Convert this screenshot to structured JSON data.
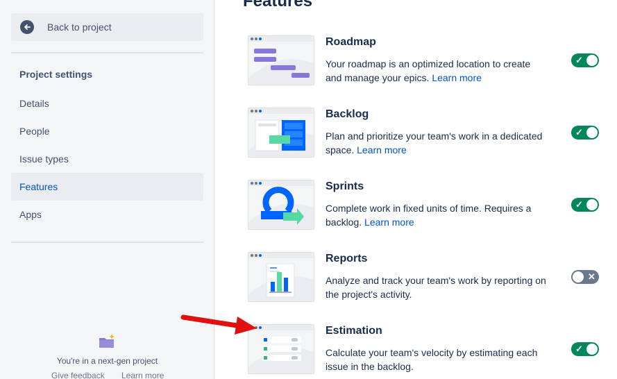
{
  "sidebar": {
    "back_label": "Back to project",
    "section_title": "Project settings",
    "items": [
      {
        "label": "Details",
        "active": false
      },
      {
        "label": "People",
        "active": false
      },
      {
        "label": "Issue types",
        "active": false
      },
      {
        "label": "Features",
        "active": true
      },
      {
        "label": "Apps",
        "active": false
      }
    ],
    "footer_text": "You're in a next-gen project",
    "footer_links": [
      "Give feedback",
      "Learn more"
    ]
  },
  "main": {
    "title": "Features",
    "features": [
      {
        "title": "Roadmap",
        "desc": "Your roadmap is an optimized location to create and manage your epics.",
        "link": "Learn more",
        "enabled": true
      },
      {
        "title": "Backlog",
        "desc": "Plan and prioritize your team's work in a dedicated space.",
        "link": "Learn more",
        "enabled": true
      },
      {
        "title": "Sprints",
        "desc": "Complete work in fixed units of time. Requires a backlog.",
        "link": "Learn more",
        "enabled": true
      },
      {
        "title": "Reports",
        "desc": "Analyze and track your team's work by reporting on the project's activity.",
        "link": "",
        "enabled": false
      },
      {
        "title": "Estimation",
        "desc": "Calculate your team's velocity by estimating each issue in the backlog.",
        "link": "",
        "enabled": true
      }
    ]
  },
  "colors": {
    "accent": "#0052cc",
    "toggle_on": "#00875a",
    "toggle_off": "#6b778c",
    "annotation_arrow": "#e01010"
  },
  "icons": {
    "back": "arrow-left-icon",
    "toggle_on": "check-icon",
    "toggle_off": "cross-icon",
    "footer": "folder-sparkle-icon"
  }
}
